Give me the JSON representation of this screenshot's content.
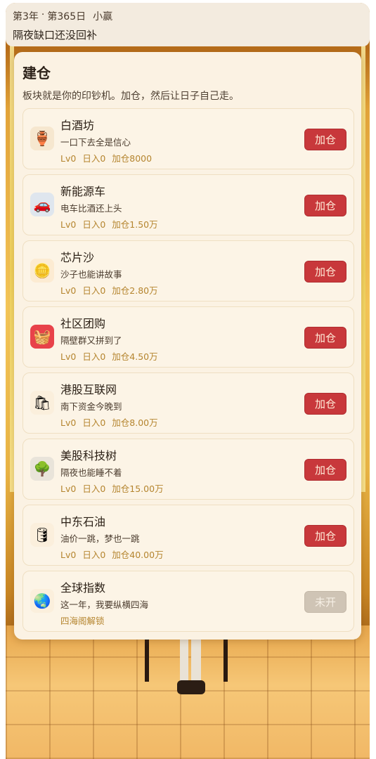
{
  "status": {
    "year": "第3年",
    "separator": "·",
    "day": "第365日",
    "player": "小赢",
    "message": "隔夜缺口还没回补"
  },
  "panel": {
    "title": "建仓",
    "subtitle": "板块就是你的印钞机。加仓，然后让日子自己走。"
  },
  "sectors": [
    {
      "name": "白酒坊",
      "desc": "一口下去全是信心",
      "level": "Lv0",
      "daily": "日入0",
      "cost": "加仓8000",
      "button": "加仓",
      "icon": "liquor-jar-icon",
      "glyph": "🏺",
      "icon_bg": "#f6e7cf"
    },
    {
      "name": "新能源车",
      "desc": "电车比酒还上头",
      "level": "Lv0",
      "daily": "日入0",
      "cost": "加仓1.50万",
      "button": "加仓",
      "icon": "car-icon",
      "glyph": "🚗",
      "icon_bg": "#dfe6ee"
    },
    {
      "name": "芯片沙",
      "desc": "沙子也能讲故事",
      "level": "Lv0",
      "daily": "日入0",
      "cost": "加仓2.80万",
      "button": "加仓",
      "icon": "chip-coin-icon",
      "glyph": "🪙",
      "icon_bg": "#fcebd2"
    },
    {
      "name": "社区团购",
      "desc": "隔壁群又拼到了",
      "level": "Lv0",
      "daily": "日入0",
      "cost": "加仓4.50万",
      "button": "加仓",
      "icon": "shopping-basket-icon",
      "glyph": "🧺",
      "icon_bg": "#e8424a"
    },
    {
      "name": "港股互联网",
      "desc": "南下资金今晚到",
      "level": "Lv0",
      "daily": "日入0",
      "cost": "加仓8.00万",
      "button": "加仓",
      "icon": "shopping-bag-icon",
      "glyph": "🛍",
      "icon_bg": "#fbefdc"
    },
    {
      "name": "美股科技树",
      "desc": "隔夜也能睡不着",
      "level": "Lv0",
      "daily": "日入0",
      "cost": "加仓15.00万",
      "button": "加仓",
      "icon": "tree-icon",
      "glyph": "🌳",
      "icon_bg": "#e9e4da"
    },
    {
      "name": "中东石油",
      "desc": "油价一跳，梦也一跳",
      "level": "Lv0",
      "daily": "日入0",
      "cost": "加仓40.00万",
      "button": "加仓",
      "icon": "oil-drop-icon",
      "glyph": "🛢",
      "icon_bg": "#fbefdc"
    },
    {
      "name": "全球指数",
      "desc": "这一年，我要纵横四海",
      "level": "",
      "daily": "",
      "cost": "",
      "unlock": "四海阁解锁",
      "button": "未开",
      "icon": "globe-icon",
      "glyph": "🌏",
      "icon_bg": "#fbefdc",
      "locked": true
    }
  ],
  "colors": {
    "button": "#c8383b",
    "button_locked": "#cfc4b5",
    "stats_text": "#b5852f",
    "panel_bg": "#fbf2e3"
  }
}
